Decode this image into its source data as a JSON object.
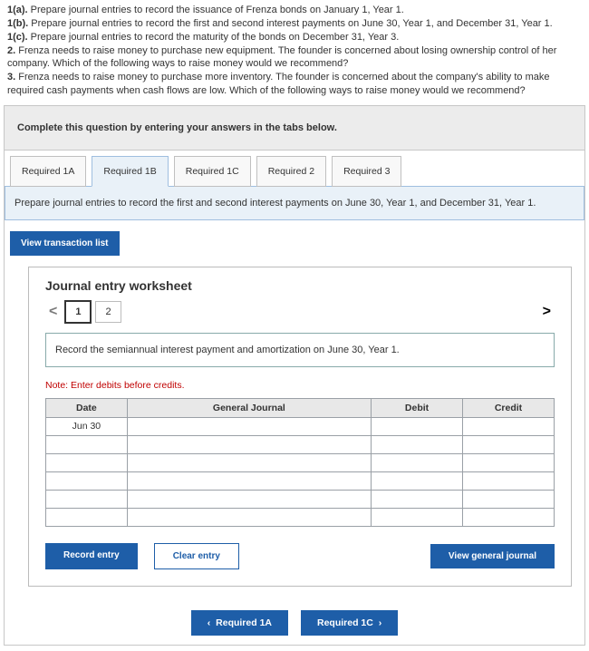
{
  "questions": {
    "q1a_label": "1(a).",
    "q1a_text": " Prepare journal entries to record the issuance of Frenza bonds on January 1, Year 1.",
    "q1b_label": "1(b).",
    "q1b_text": " Prepare journal entries to record the first and second interest payments on June 30, Year 1, and December 31, Year 1.",
    "q1c_label": "1(c).",
    "q1c_text": " Prepare journal entries to record the maturity of the bonds on December 31, Year 3.",
    "q2_label": "2.",
    "q2_text": " Frenza needs to raise money to purchase new equipment. The founder is concerned about losing ownership control of her company. Which of the following ways to raise money would we recommend?",
    "q3_label": "3.",
    "q3_text": " Frenza needs to raise money to purchase more inventory. The founder is concerned about the company's ability to make required cash payments when cash flows are low. Which of the following ways to raise money would we recommend?"
  },
  "instruction": "Complete this question by entering your answers in the tabs below.",
  "tabs": [
    "Required 1A",
    "Required 1B",
    "Required 1C",
    "Required 2",
    "Required 3"
  ],
  "active_tab_prompt": "Prepare journal entries to record the first and second interest payments on June 30, Year 1, and December 31, Year 1.",
  "view_tl": "View transaction list",
  "worksheet": {
    "title": "Journal entry worksheet",
    "pages": [
      "1",
      "2"
    ],
    "entry_desc": "Record the semiannual interest payment and amortization on June 30, Year 1.",
    "note": "Note: Enter debits before credits.",
    "headers": {
      "date": "Date",
      "gj": "General Journal",
      "debit": "Debit",
      "credit": "Credit"
    },
    "first_date": "Jun 30",
    "record_btn": "Record entry",
    "clear_btn": "Clear entry",
    "view_gj_btn": "View general journal"
  },
  "nav": {
    "prev_chev": "‹",
    "prev": "Required 1A",
    "next": "Required 1C",
    "next_chev": "›"
  },
  "glyph": {
    "lt": "<",
    "gt": ">"
  }
}
